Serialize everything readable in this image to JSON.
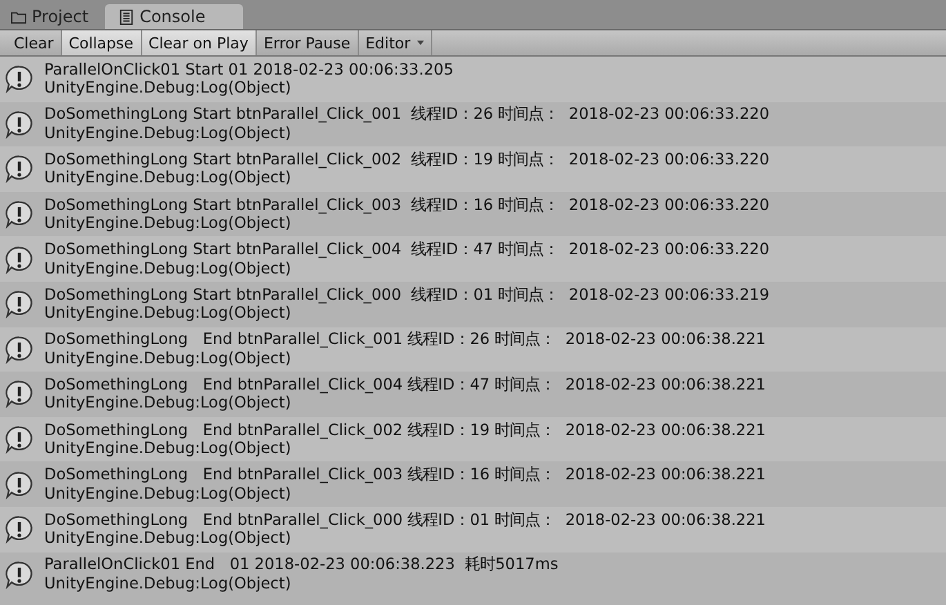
{
  "tabs": [
    {
      "label": "Project",
      "kind": "folder",
      "selected": false
    },
    {
      "label": "Console",
      "kind": "console",
      "selected": true
    }
  ],
  "toolbar": [
    {
      "label": "Clear",
      "kind": "button",
      "on": false
    },
    {
      "label": "Collapse",
      "kind": "toggle",
      "on": true
    },
    {
      "label": "Clear on Play",
      "kind": "toggle",
      "on": true
    },
    {
      "label": "Error Pause",
      "kind": "toggle",
      "on": false
    },
    {
      "label": "Editor",
      "kind": "dropdown",
      "on": false
    }
  ],
  "log": [
    {
      "message": "ParallelOnClick01 Start 01 2018-02-23 00:06:33.205",
      "trace": "UnityEngine.Debug:Log(Object)"
    },
    {
      "message": "DoSomethingLong Start btnParallel_Click_001  线程ID：26 时间点：  2018-02-23 00:06:33.220",
      "trace": "UnityEngine.Debug:Log(Object)"
    },
    {
      "message": "DoSomethingLong Start btnParallel_Click_002  线程ID：19 时间点：  2018-02-23 00:06:33.220",
      "trace": "UnityEngine.Debug:Log(Object)"
    },
    {
      "message": "DoSomethingLong Start btnParallel_Click_003  线程ID：16 时间点：  2018-02-23 00:06:33.220",
      "trace": "UnityEngine.Debug:Log(Object)"
    },
    {
      "message": "DoSomethingLong Start btnParallel_Click_004  线程ID：47 时间点：  2018-02-23 00:06:33.220",
      "trace": "UnityEngine.Debug:Log(Object)"
    },
    {
      "message": "DoSomethingLong Start btnParallel_Click_000  线程ID：01 时间点：  2018-02-23 00:06:33.219",
      "trace": "UnityEngine.Debug:Log(Object)"
    },
    {
      "message": "DoSomethingLong   End btnParallel_Click_001 线程ID：26 时间点：  2018-02-23 00:06:38.221",
      "trace": "UnityEngine.Debug:Log(Object)"
    },
    {
      "message": "DoSomethingLong   End btnParallel_Click_004 线程ID：47 时间点：  2018-02-23 00:06:38.221",
      "trace": "UnityEngine.Debug:Log(Object)"
    },
    {
      "message": "DoSomethingLong   End btnParallel_Click_002 线程ID：19 时间点：  2018-02-23 00:06:38.221",
      "trace": "UnityEngine.Debug:Log(Object)"
    },
    {
      "message": "DoSomethingLong   End btnParallel_Click_003 线程ID：16 时间点：  2018-02-23 00:06:38.221",
      "trace": "UnityEngine.Debug:Log(Object)"
    },
    {
      "message": "DoSomethingLong   End btnParallel_Click_000 线程ID：01 时间点：  2018-02-23 00:06:38.221",
      "trace": "UnityEngine.Debug:Log(Object)"
    },
    {
      "message": "ParallelOnClick01 End   01 2018-02-23 00:06:38.223  耗时5017ms",
      "trace": "UnityEngine.Debug:Log(Object)"
    }
  ]
}
